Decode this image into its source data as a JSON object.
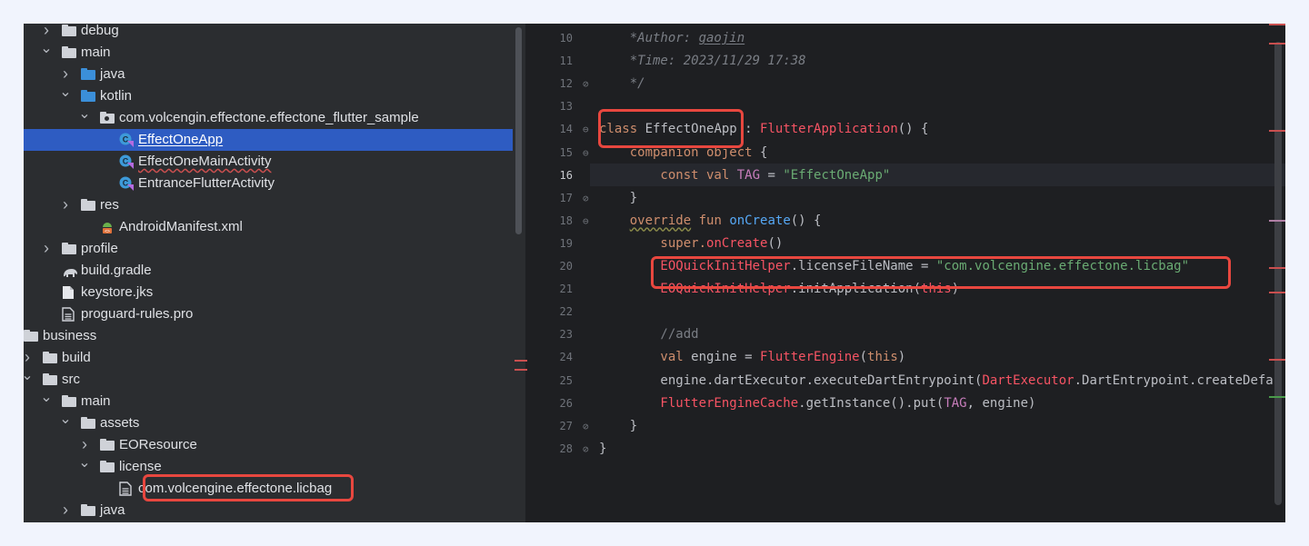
{
  "tree": {
    "items": [
      {
        "label": "debug",
        "kind": "folder",
        "color": "gray",
        "expanded": false,
        "depth": 3
      },
      {
        "label": "main",
        "kind": "folder",
        "color": "gray",
        "expanded": true,
        "depth": 3
      },
      {
        "label": "java",
        "kind": "folder",
        "color": "blue",
        "expanded": false,
        "depth": 4
      },
      {
        "label": "kotlin",
        "kind": "folder",
        "color": "blue",
        "expanded": true,
        "depth": 4
      },
      {
        "label": "com.volcengin.effectone.effectone_flutter_sample",
        "kind": "package",
        "expanded": true,
        "depth": 5
      },
      {
        "label": "EffectOneApp",
        "kind": "kotlin-class",
        "depth": 6,
        "selected": true
      },
      {
        "label": "EffectOneMainActivity",
        "kind": "kotlin-class",
        "depth": 6
      },
      {
        "label": "EntranceFlutterActivity",
        "kind": "kotlin-class",
        "depth": 6
      },
      {
        "label": "res",
        "kind": "folder",
        "color": "gray",
        "expanded": false,
        "depth": 4
      },
      {
        "label": "AndroidManifest.xml",
        "kind": "manifest",
        "depth": 5
      },
      {
        "label": "profile",
        "kind": "folder",
        "color": "gray",
        "expanded": false,
        "depth": 3
      },
      {
        "label": "build.gradle",
        "kind": "gradle",
        "depth": 3
      },
      {
        "label": "keystore.jks",
        "kind": "file",
        "depth": 3
      },
      {
        "label": "proguard-rules.pro",
        "kind": "text-file",
        "depth": 3
      },
      {
        "label": "business",
        "kind": "folder",
        "color": "gray",
        "expanded": true,
        "depth": 1
      },
      {
        "label": "build",
        "kind": "folder",
        "color": "gray",
        "expanded": false,
        "depth": 2
      },
      {
        "label": "src",
        "kind": "folder",
        "color": "gray",
        "expanded": true,
        "depth": 2
      },
      {
        "label": "main",
        "kind": "folder",
        "color": "gray",
        "expanded": true,
        "depth": 3
      },
      {
        "label": "assets",
        "kind": "folder",
        "color": "gray",
        "expanded": true,
        "depth": 4
      },
      {
        "label": "EOResource",
        "kind": "folder",
        "color": "gray",
        "expanded": false,
        "depth": 5
      },
      {
        "label": "license",
        "kind": "folder",
        "color": "gray",
        "expanded": true,
        "depth": 5
      },
      {
        "label": "com.volcengine.effectone.licbag",
        "kind": "text-file",
        "depth": 6
      },
      {
        "label": "java",
        "kind": "folder",
        "color": "gray",
        "expanded": false,
        "depth": 4
      }
    ]
  },
  "editor": {
    "current_line": "16",
    "lines": [
      {
        "n": "10",
        "parts": [
          {
            "t": "    *Author: ",
            "c": "cmt"
          },
          {
            "t": "gaojin",
            "c": "cmt under"
          }
        ]
      },
      {
        "n": "11",
        "parts": [
          {
            "t": "    *Time: 2023/11/29 17:38",
            "c": "cmt"
          }
        ]
      },
      {
        "n": "12",
        "parts": [
          {
            "t": "    */",
            "c": "cmt"
          }
        ]
      },
      {
        "n": "13",
        "parts": []
      },
      {
        "n": "14",
        "parts": [
          {
            "t": "class",
            "c": "kw"
          },
          {
            "t": " EffectOneApp",
            "c": "plain"
          },
          {
            "t": " : ",
            "c": "plain"
          },
          {
            "t": "FlutterApplication",
            "c": "err"
          },
          {
            "t": "() {",
            "c": "plain"
          }
        ]
      },
      {
        "n": "15",
        "parts": [
          {
            "t": "    companion object",
            "c": "kw"
          },
          {
            "t": " {",
            "c": "plain"
          }
        ]
      },
      {
        "n": "16",
        "parts": [
          {
            "t": "        const val ",
            "c": "kw"
          },
          {
            "t": "TAG",
            "c": "tagv"
          },
          {
            "t": " = ",
            "c": "plain"
          },
          {
            "t": "\"EffectOneApp\"",
            "c": "str"
          }
        ]
      },
      {
        "n": "17",
        "parts": [
          {
            "t": "    }",
            "c": "plain"
          }
        ]
      },
      {
        "n": "18",
        "parts": [
          {
            "t": "    ",
            "c": "plain"
          },
          {
            "t": "override",
            "c": "kw wavy"
          },
          {
            "t": " fun ",
            "c": "kw"
          },
          {
            "t": "onCreate",
            "c": "fn"
          },
          {
            "t": "() {",
            "c": "plain"
          }
        ]
      },
      {
        "n": "19",
        "parts": [
          {
            "t": "        super.",
            "c": "kw"
          },
          {
            "t": "onCreate",
            "c": "err"
          },
          {
            "t": "()",
            "c": "plain"
          }
        ]
      },
      {
        "n": "20",
        "parts": [
          {
            "t": "        EOQuickInitHelper",
            "c": "err"
          },
          {
            "t": ".licenseFileName",
            "c": "plain"
          },
          {
            "t": " = ",
            "c": "plain"
          },
          {
            "t": "\"com.volcengine.effectone.licbag\"",
            "c": "str"
          }
        ]
      },
      {
        "n": "21",
        "parts": [
          {
            "t": "        EOQuickInitHelper",
            "c": "err"
          },
          {
            "t": ".initApplication(",
            "c": "plain"
          },
          {
            "t": "this",
            "c": "err"
          },
          {
            "t": ")",
            "c": "plain"
          }
        ]
      },
      {
        "n": "22",
        "parts": []
      },
      {
        "n": "23",
        "parts": [
          {
            "t": "        //add",
            "c": "cmt2"
          }
        ]
      },
      {
        "n": "24",
        "parts": [
          {
            "t": "        val",
            "c": "kw"
          },
          {
            "t": " engine = ",
            "c": "plain"
          },
          {
            "t": "FlutterEngine",
            "c": "err"
          },
          {
            "t": "(",
            "c": "plain"
          },
          {
            "t": "this",
            "c": "kw"
          },
          {
            "t": ")",
            "c": "plain"
          }
        ]
      },
      {
        "n": "25",
        "parts": [
          {
            "t": "        engine.dartExecutor.executeDartEntrypoint(",
            "c": "plain"
          },
          {
            "t": "DartExecutor",
            "c": "err"
          },
          {
            "t": ".DartEntrypoint.createDefa",
            "c": "plain"
          }
        ]
      },
      {
        "n": "26",
        "parts": [
          {
            "t": "        FlutterEngineCache",
            "c": "err"
          },
          {
            "t": ".getInstance().put(",
            "c": "plain"
          },
          {
            "t": "TAG",
            "c": "tagv"
          },
          {
            "t": ", engine)",
            "c": "plain"
          }
        ]
      },
      {
        "n": "27",
        "parts": [
          {
            "t": "    }",
            "c": "plain"
          }
        ]
      },
      {
        "n": "28",
        "parts": [
          {
            "t": "}",
            "c": "plain"
          }
        ]
      }
    ]
  },
  "colors": {
    "highlight_box": "#e8473f",
    "selection": "#2e5cc2",
    "editor_bg": "#1e1f22",
    "tree_bg": "#2b2d30"
  }
}
